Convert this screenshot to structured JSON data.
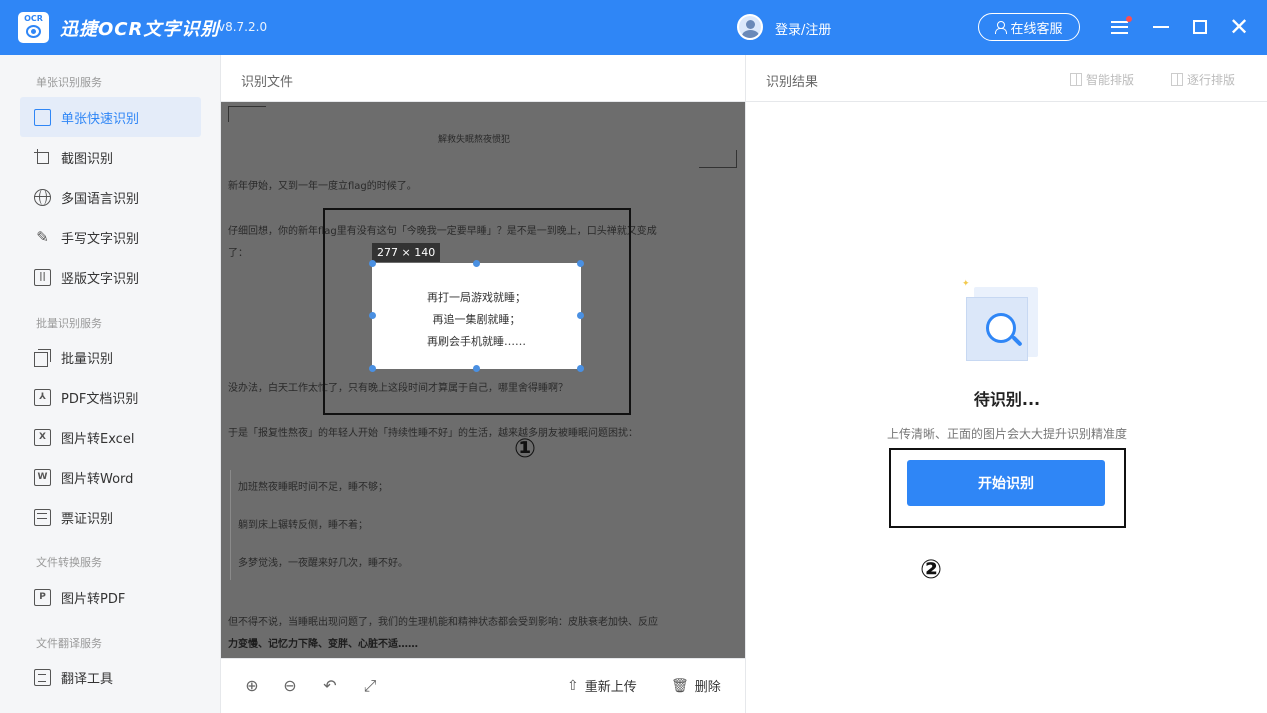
{
  "titlebar": {
    "app_name": "迅捷OCR文字识别",
    "version": "v8.7.2.0",
    "logo_text": "OCR",
    "login": "登录/注册",
    "service": "在线客服",
    "accent": "#2f86f6"
  },
  "sidebar": {
    "sections": [
      {
        "label": "单张识别服务"
      },
      {
        "label": "批量识别服务"
      },
      {
        "label": "文件转换服务"
      },
      {
        "label": "文件翻译服务"
      }
    ],
    "items": [
      {
        "label": "单张快速识别",
        "icon": "quick-recognize-icon",
        "active": true
      },
      {
        "label": "截图识别",
        "icon": "crop-icon"
      },
      {
        "label": "多国语言识别",
        "icon": "globe-icon"
      },
      {
        "label": "手写文字识别",
        "icon": "pen-icon"
      },
      {
        "label": "竖版文字识别",
        "icon": "vertical-text-icon"
      },
      {
        "label": "批量识别",
        "icon": "batch-icon"
      },
      {
        "label": "PDF文档识别",
        "icon": "pdf-doc-icon"
      },
      {
        "label": "图片转Excel",
        "icon": "excel-icon",
        "letter": "X"
      },
      {
        "label": "图片转Word",
        "icon": "word-icon",
        "letter": "W"
      },
      {
        "label": "票证识别",
        "icon": "ticket-icon"
      },
      {
        "label": "图片转PDF",
        "icon": "pdf-icon",
        "letter": "P"
      },
      {
        "label": "翻译工具",
        "icon": "translate-icon"
      }
    ]
  },
  "center": {
    "header": "识别文件",
    "doc_title": "解救失眠熬夜惯犯",
    "lines": [
      "新年伊始，又到一年一度立flag的时候了。",
      "仔细回想，你的新年flag里有没有这句「今晚我一定要早睡」？是不是一到晚上，口头禅就又变成",
      "了：",
      "没办法，白天工作太忙了，只有晚上这段时间才算属于自己，哪里舍得睡啊？",
      "于是「报复性熬夜」的年轻人开始「持续性睡不好」的生活，越来越多朋友被睡眠问题困扰：",
      "加班熬夜睡眠时间不足，睡不够；",
      "躺到床上辗转反侧，睡不着；",
      "多梦觉浅，一夜醒来好几次，睡不好。",
      "但不得不说，当睡眠出现问题了，我们的生理机能和精神状态都会受到影响：皮肤衰老加快、反应",
      "力变慢、记忆力下降、变胖、心脏不适……"
    ],
    "selection_size": "277 × 140",
    "selection_lines": [
      "再打一局游戏就睡；",
      "再追一集剧就睡；",
      "再刷会手机就睡……"
    ],
    "marker_1": "①",
    "footer": {
      "reupload": "重新上传",
      "delete": "删除"
    }
  },
  "right": {
    "header": "识别结果",
    "smart_layout": "智能排版",
    "line_layout": "逐行排版",
    "pending_title": "待识别...",
    "pending_sub": "上传清晰、正面的图片会大大提升识别精准度",
    "start_button": "开始识别",
    "marker_2": "②"
  }
}
